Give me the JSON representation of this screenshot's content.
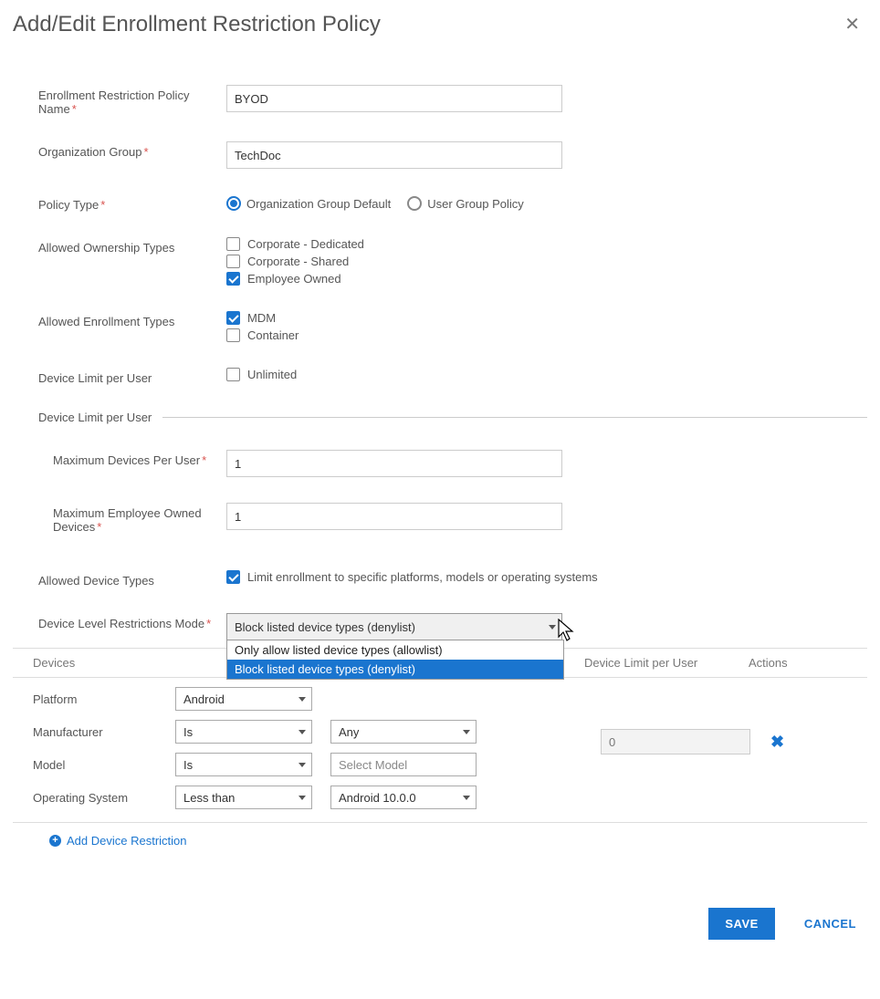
{
  "dialog": {
    "title": "Add/Edit Enrollment Restriction Policy",
    "close_icon": "close"
  },
  "fields": {
    "policy_name": {
      "label": "Enrollment Restriction Policy Name",
      "value": "BYOD"
    },
    "org_group": {
      "label": "Organization Group",
      "value": "TechDoc"
    },
    "policy_type": {
      "label": "Policy Type",
      "options": [
        {
          "label": "Organization Group Default",
          "selected": true
        },
        {
          "label": "User Group Policy",
          "selected": false
        }
      ]
    },
    "ownership_types": {
      "label": "Allowed Ownership Types",
      "options": [
        {
          "label": "Corporate - Dedicated",
          "checked": false
        },
        {
          "label": "Corporate - Shared",
          "checked": false
        },
        {
          "label": "Employee Owned",
          "checked": true
        }
      ]
    },
    "enrollment_types": {
      "label": "Allowed Enrollment Types",
      "options": [
        {
          "label": "MDM",
          "checked": true
        },
        {
          "label": "Container",
          "checked": false
        }
      ]
    },
    "device_limit_per_user": {
      "label": "Device Limit per User",
      "unlimited_label": "Unlimited",
      "unlimited_checked": false
    }
  },
  "device_limit_section": {
    "heading": "Device Limit per User",
    "max_devices": {
      "label": "Maximum Devices Per User",
      "value": "1"
    },
    "max_employee_owned": {
      "label": "Maximum Employee Owned Devices",
      "value": "1"
    }
  },
  "allowed_device_types": {
    "label": "Allowed Device Types",
    "checkbox_label": "Limit enrollment to specific platforms, models or operating systems",
    "checked": true
  },
  "restrictions_mode": {
    "label": "Device Level Restrictions Mode",
    "selected": "Block listed device types (denylist)",
    "options": [
      {
        "label": "Only allow listed device types (allowlist)",
        "highlight": false
      },
      {
        "label": "Block listed device types (denylist)",
        "highlight": true
      }
    ]
  },
  "devices_table": {
    "headers": {
      "devices": "Devices",
      "limit": "Device Limit per User",
      "actions": "Actions"
    },
    "row": {
      "platform": {
        "label": "Platform",
        "value": "Android"
      },
      "manufacturer": {
        "label": "Manufacturer",
        "op": "Is",
        "value": "Any"
      },
      "model": {
        "label": "Model",
        "op": "Is",
        "placeholder": "Select Model"
      },
      "os": {
        "label": "Operating System",
        "op": "Less than",
        "value": "Android 10.0.0"
      },
      "limit_value": "0"
    },
    "add_label": "Add Device Restriction"
  },
  "footer": {
    "save": "SAVE",
    "cancel": "CANCEL"
  }
}
